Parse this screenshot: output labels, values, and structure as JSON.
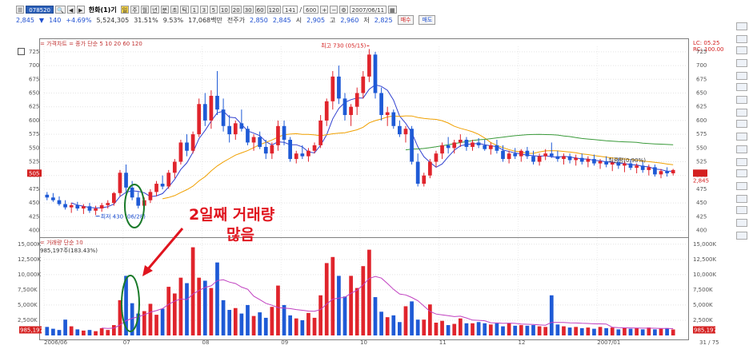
{
  "toolbar": {
    "code": "078520",
    "period_label": "일",
    "title": "한화(1)기",
    "buttons": [
      "주",
      "월",
      "년",
      "분",
      "초",
      "틱"
    ],
    "interval_buttons": [
      "1",
      "3",
      "5",
      "10",
      "20",
      "30",
      "60",
      "120"
    ],
    "count": "141",
    "total": "600",
    "date": "2007/06/11"
  },
  "quote": {
    "price": "2,845",
    "arrow": "▼",
    "change": "140",
    "pct": "+4.69%",
    "volume": "5,524,305",
    "ratio1": "31.51%",
    "ratio2": "9.53%",
    "amount": "17,068백만",
    "prev_label": "전주가",
    "prev": "2,850",
    "open_label": "시",
    "open": "2,845",
    "open2": "2,905",
    "high_label": "고",
    "high": "2,960",
    "low_label": "저",
    "low": "2,825",
    "buy": "매수",
    "sell": "매도"
  },
  "price_legend": "= 가격차트 = 종가 단순 5 10 20 60 120",
  "volume_legend": "= 거래량 단순 10",
  "volume_sub": "985,197주(183.43%)",
  "annotations": {
    "max_label": "최고 730 (05/15)",
    "min_label": "최저 430 (06/28)",
    "avg_label": "최종평(0.90%)",
    "big_text_1": "2일째 거래량",
    "big_text_2": "많음"
  },
  "right_top": [
    "LC: 05.25",
    "RC: 100.00"
  ],
  "price_labels": [
    "725",
    "700",
    "675",
    "650",
    "625",
    "600",
    "575",
    "550",
    "525",
    "500",
    "475",
    "450",
    "425",
    "400"
  ],
  "volume_labels": [
    "15,000K",
    "12,500K",
    "10,000K",
    "7,500K",
    "5,000K",
    "2,500K"
  ],
  "x_labels": [
    "2006/06",
    "07",
    "08",
    "09",
    "10",
    "11",
    "12",
    "2007/01"
  ],
  "current_tag": "505",
  "current_tag2": "2,845",
  "vol_tag": "985,197",
  "page_indicator": "31 / 75",
  "colors": {
    "up": "#e0242c",
    "down": "#1e5ad6",
    "ma5": "#3040d0",
    "ma20": "#f0a000",
    "ma60": "#3a9a3a",
    "ma120": "#6060e0",
    "vma": "#c040c0",
    "ellipse": "#1a7a2a",
    "arrow": "#e0141e"
  },
  "chart_data": {
    "type": "candlestick",
    "ylim": [
      395,
      735
    ],
    "vol_ylim": [
      0,
      15500
    ],
    "candles": [
      [
        465,
        470,
        455,
        460
      ],
      [
        460,
        468,
        452,
        455
      ],
      [
        455,
        462,
        445,
        448
      ],
      [
        448,
        455,
        438,
        442
      ],
      [
        442,
        450,
        432,
        446
      ],
      [
        446,
        452,
        436,
        440
      ],
      [
        440,
        448,
        430,
        444
      ],
      [
        444,
        450,
        432,
        436
      ],
      [
        436,
        445,
        428,
        440
      ],
      [
        440,
        450,
        434,
        446
      ],
      [
        446,
        455,
        440,
        450
      ],
      [
        450,
        470,
        445,
        468
      ],
      [
        468,
        510,
        462,
        505
      ],
      [
        505,
        520,
        470,
        478
      ],
      [
        478,
        490,
        455,
        460
      ],
      [
        460,
        470,
        440,
        445
      ],
      [
        445,
        460,
        438,
        455
      ],
      [
        455,
        475,
        450,
        470
      ],
      [
        470,
        490,
        462,
        485
      ],
      [
        485,
        500,
        475,
        480
      ],
      [
        480,
        510,
        476,
        505
      ],
      [
        505,
        530,
        495,
        525
      ],
      [
        525,
        565,
        520,
        560
      ],
      [
        560,
        575,
        535,
        545
      ],
      [
        545,
        580,
        540,
        575
      ],
      [
        575,
        640,
        570,
        630
      ],
      [
        630,
        650,
        590,
        600
      ],
      [
        600,
        655,
        585,
        645
      ],
      [
        645,
        690,
        610,
        620
      ],
      [
        620,
        640,
        580,
        590
      ],
      [
        590,
        610,
        560,
        575
      ],
      [
        575,
        600,
        565,
        595
      ],
      [
        595,
        620,
        580,
        585
      ],
      [
        585,
        590,
        555,
        560
      ],
      [
        560,
        575,
        545,
        570
      ],
      [
        570,
        580,
        548,
        552
      ],
      [
        552,
        565,
        530,
        540
      ],
      [
        540,
        560,
        530,
        555
      ],
      [
        555,
        600,
        545,
        590
      ],
      [
        590,
        600,
        555,
        565
      ],
      [
        565,
        570,
        525,
        530
      ],
      [
        530,
        545,
        522,
        540
      ],
      [
        540,
        555,
        530,
        535
      ],
      [
        535,
        550,
        525,
        545
      ],
      [
        545,
        560,
        540,
        555
      ],
      [
        555,
        610,
        550,
        600
      ],
      [
        600,
        640,
        590,
        635
      ],
      [
        635,
        690,
        620,
        680
      ],
      [
        680,
        700,
        630,
        640
      ],
      [
        640,
        650,
        600,
        610
      ],
      [
        610,
        630,
        590,
        625
      ],
      [
        625,
        660,
        610,
        650
      ],
      [
        650,
        690,
        640,
        680
      ],
      [
        680,
        730,
        670,
        720
      ],
      [
        720,
        725,
        640,
        650
      ],
      [
        650,
        660,
        600,
        610
      ],
      [
        610,
        625,
        590,
        615
      ],
      [
        615,
        620,
        585,
        590
      ],
      [
        590,
        600,
        570,
        575
      ],
      [
        575,
        590,
        560,
        585
      ],
      [
        585,
        590,
        520,
        525
      ],
      [
        525,
        540,
        480,
        485
      ],
      [
        485,
        505,
        480,
        500
      ],
      [
        500,
        530,
        495,
        525
      ],
      [
        525,
        545,
        515,
        540
      ],
      [
        540,
        560,
        530,
        555
      ],
      [
        555,
        570,
        540,
        550
      ],
      [
        550,
        565,
        540,
        560
      ],
      [
        560,
        575,
        552,
        565
      ],
      [
        565,
        570,
        545,
        552
      ],
      [
        552,
        565,
        545,
        560
      ],
      [
        560,
        568,
        550,
        555
      ],
      [
        555,
        565,
        545,
        548
      ],
      [
        548,
        560,
        538,
        555
      ],
      [
        555,
        565,
        540,
        545
      ],
      [
        545,
        555,
        525,
        530
      ],
      [
        530,
        545,
        522,
        540
      ],
      [
        540,
        550,
        530,
        535
      ],
      [
        535,
        548,
        525,
        545
      ],
      [
        545,
        552,
        530,
        535
      ],
      [
        535,
        545,
        520,
        525
      ],
      [
        525,
        540,
        518,
        535
      ],
      [
        535,
        548,
        528,
        540
      ],
      [
        540,
        560,
        532,
        535
      ],
      [
        535,
        545,
        525,
        530
      ],
      [
        530,
        540,
        520,
        535
      ],
      [
        535,
        540,
        522,
        528
      ],
      [
        528,
        538,
        518,
        532
      ],
      [
        532,
        540,
        520,
        525
      ],
      [
        525,
        535,
        515,
        530
      ],
      [
        530,
        538,
        518,
        522
      ],
      [
        522,
        530,
        512,
        526
      ],
      [
        526,
        535,
        515,
        520
      ],
      [
        520,
        528,
        508,
        524
      ],
      [
        524,
        532,
        512,
        518
      ],
      [
        518,
        526,
        506,
        522
      ],
      [
        522,
        530,
        510,
        514
      ],
      [
        514,
        522,
        504,
        518
      ],
      [
        518,
        525,
        505,
        510
      ],
      [
        510,
        520,
        500,
        515
      ],
      [
        515,
        520,
        498,
        502
      ],
      [
        502,
        512,
        495,
        508
      ],
      [
        508,
        515,
        498,
        504
      ],
      [
        504,
        512,
        500,
        510
      ]
    ],
    "volumes": [
      1400,
      1100,
      900,
      2600,
      1500,
      1000,
      800,
      900,
      700,
      1200,
      900,
      1700,
      5800,
      9800,
      5300,
      3600,
      4000,
      5200,
      3400,
      4400,
      8000,
      6900,
      9500,
      8600,
      14500,
      9500,
      9000,
      7800,
      12000,
      5800,
      4200,
      4500,
      3600,
      5000,
      3200,
      3800,
      2900,
      4700,
      8200,
      5000,
      3300,
      2800,
      2500,
      3700,
      2900,
      6600,
      11900,
      12900,
      9800,
      6400,
      9800,
      7800,
      11400,
      14100,
      6300,
      3900,
      3000,
      3300,
      2200,
      4800,
      5600,
      2600,
      2600,
      5100,
      2100,
      2400,
      1700,
      1900,
      2800,
      2000,
      2000,
      2200,
      2000,
      1800,
      2000,
      1500,
      2000,
      1600,
      1700,
      1600,
      1700,
      1500,
      1400,
      6600,
      1800,
      1500,
      1300,
      1400,
      1200,
      1300,
      1100,
      1400,
      1200,
      1300,
      1000,
      1300,
      1100,
      1200,
      1000,
      1300,
      1000,
      1100,
      1200,
      985
    ]
  }
}
